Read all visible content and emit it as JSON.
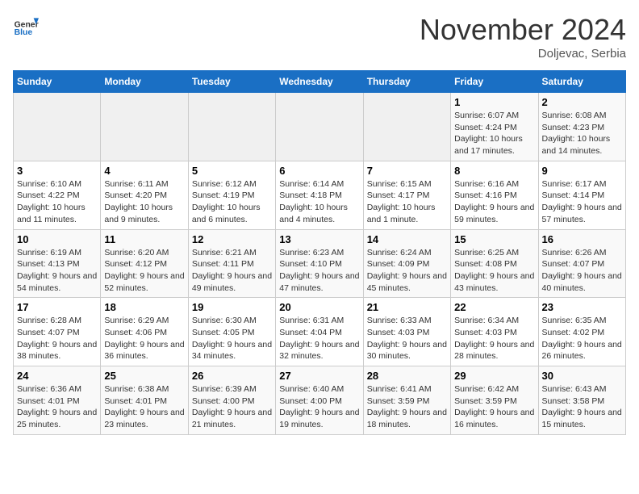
{
  "header": {
    "logo_general": "General",
    "logo_blue": "Blue",
    "month_title": "November 2024",
    "location": "Doljevac, Serbia"
  },
  "days_of_week": [
    "Sunday",
    "Monday",
    "Tuesday",
    "Wednesday",
    "Thursday",
    "Friday",
    "Saturday"
  ],
  "weeks": [
    [
      {
        "day": "",
        "info": ""
      },
      {
        "day": "",
        "info": ""
      },
      {
        "day": "",
        "info": ""
      },
      {
        "day": "",
        "info": ""
      },
      {
        "day": "",
        "info": ""
      },
      {
        "day": "1",
        "info": "Sunrise: 6:07 AM\nSunset: 4:24 PM\nDaylight: 10 hours and 17 minutes."
      },
      {
        "day": "2",
        "info": "Sunrise: 6:08 AM\nSunset: 4:23 PM\nDaylight: 10 hours and 14 minutes."
      }
    ],
    [
      {
        "day": "3",
        "info": "Sunrise: 6:10 AM\nSunset: 4:22 PM\nDaylight: 10 hours and 11 minutes."
      },
      {
        "day": "4",
        "info": "Sunrise: 6:11 AM\nSunset: 4:20 PM\nDaylight: 10 hours and 9 minutes."
      },
      {
        "day": "5",
        "info": "Sunrise: 6:12 AM\nSunset: 4:19 PM\nDaylight: 10 hours and 6 minutes."
      },
      {
        "day": "6",
        "info": "Sunrise: 6:14 AM\nSunset: 4:18 PM\nDaylight: 10 hours and 4 minutes."
      },
      {
        "day": "7",
        "info": "Sunrise: 6:15 AM\nSunset: 4:17 PM\nDaylight: 10 hours and 1 minute."
      },
      {
        "day": "8",
        "info": "Sunrise: 6:16 AM\nSunset: 4:16 PM\nDaylight: 9 hours and 59 minutes."
      },
      {
        "day": "9",
        "info": "Sunrise: 6:17 AM\nSunset: 4:14 PM\nDaylight: 9 hours and 57 minutes."
      }
    ],
    [
      {
        "day": "10",
        "info": "Sunrise: 6:19 AM\nSunset: 4:13 PM\nDaylight: 9 hours and 54 minutes."
      },
      {
        "day": "11",
        "info": "Sunrise: 6:20 AM\nSunset: 4:12 PM\nDaylight: 9 hours and 52 minutes."
      },
      {
        "day": "12",
        "info": "Sunrise: 6:21 AM\nSunset: 4:11 PM\nDaylight: 9 hours and 49 minutes."
      },
      {
        "day": "13",
        "info": "Sunrise: 6:23 AM\nSunset: 4:10 PM\nDaylight: 9 hours and 47 minutes."
      },
      {
        "day": "14",
        "info": "Sunrise: 6:24 AM\nSunset: 4:09 PM\nDaylight: 9 hours and 45 minutes."
      },
      {
        "day": "15",
        "info": "Sunrise: 6:25 AM\nSunset: 4:08 PM\nDaylight: 9 hours and 43 minutes."
      },
      {
        "day": "16",
        "info": "Sunrise: 6:26 AM\nSunset: 4:07 PM\nDaylight: 9 hours and 40 minutes."
      }
    ],
    [
      {
        "day": "17",
        "info": "Sunrise: 6:28 AM\nSunset: 4:07 PM\nDaylight: 9 hours and 38 minutes."
      },
      {
        "day": "18",
        "info": "Sunrise: 6:29 AM\nSunset: 4:06 PM\nDaylight: 9 hours and 36 minutes."
      },
      {
        "day": "19",
        "info": "Sunrise: 6:30 AM\nSunset: 4:05 PM\nDaylight: 9 hours and 34 minutes."
      },
      {
        "day": "20",
        "info": "Sunrise: 6:31 AM\nSunset: 4:04 PM\nDaylight: 9 hours and 32 minutes."
      },
      {
        "day": "21",
        "info": "Sunrise: 6:33 AM\nSunset: 4:03 PM\nDaylight: 9 hours and 30 minutes."
      },
      {
        "day": "22",
        "info": "Sunrise: 6:34 AM\nSunset: 4:03 PM\nDaylight: 9 hours and 28 minutes."
      },
      {
        "day": "23",
        "info": "Sunrise: 6:35 AM\nSunset: 4:02 PM\nDaylight: 9 hours and 26 minutes."
      }
    ],
    [
      {
        "day": "24",
        "info": "Sunrise: 6:36 AM\nSunset: 4:01 PM\nDaylight: 9 hours and 25 minutes."
      },
      {
        "day": "25",
        "info": "Sunrise: 6:38 AM\nSunset: 4:01 PM\nDaylight: 9 hours and 23 minutes."
      },
      {
        "day": "26",
        "info": "Sunrise: 6:39 AM\nSunset: 4:00 PM\nDaylight: 9 hours and 21 minutes."
      },
      {
        "day": "27",
        "info": "Sunrise: 6:40 AM\nSunset: 4:00 PM\nDaylight: 9 hours and 19 minutes."
      },
      {
        "day": "28",
        "info": "Sunrise: 6:41 AM\nSunset: 3:59 PM\nDaylight: 9 hours and 18 minutes."
      },
      {
        "day": "29",
        "info": "Sunrise: 6:42 AM\nSunset: 3:59 PM\nDaylight: 9 hours and 16 minutes."
      },
      {
        "day": "30",
        "info": "Sunrise: 6:43 AM\nSunset: 3:58 PM\nDaylight: 9 hours and 15 minutes."
      }
    ]
  ]
}
